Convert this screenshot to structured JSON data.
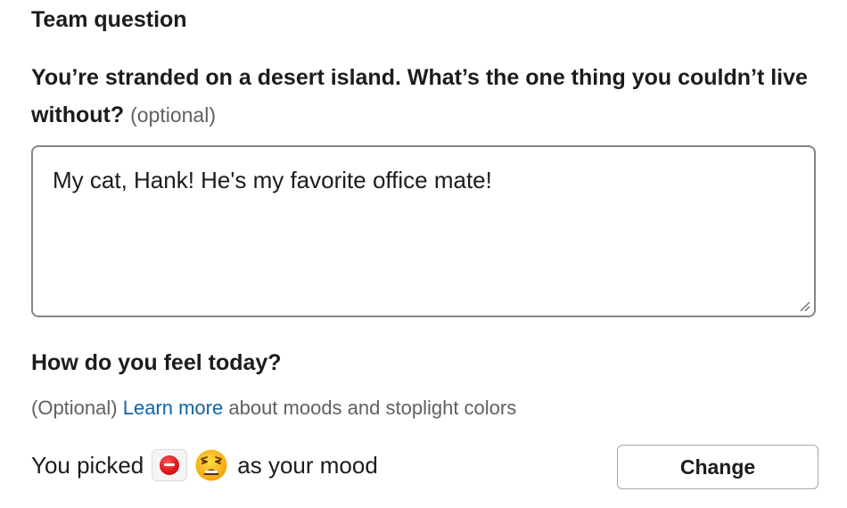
{
  "section": {
    "title": "Team question"
  },
  "question": {
    "text": "You’re stranded on a desert island. What’s the one thing you couldn’t live without?",
    "optional_label": "(optional)"
  },
  "answer": {
    "value": "My cat, Hank! He's my favorite office mate!"
  },
  "mood": {
    "title": "How do you feel today?",
    "help_prefix": "(Optional)",
    "help_link": "Learn more",
    "help_suffix": "about moods and stoplight colors",
    "picked_prefix": "You picked",
    "picked_suffix": "as your mood",
    "stoplight_color": "#e0161a",
    "stoplight_icon": "red-stoplight-icon",
    "emoji_icon": "weary-face-emoji-icon",
    "change_label": "Change"
  },
  "colors": {
    "link": "#1264a3",
    "muted": "#616061",
    "text": "#1d1c1d"
  }
}
